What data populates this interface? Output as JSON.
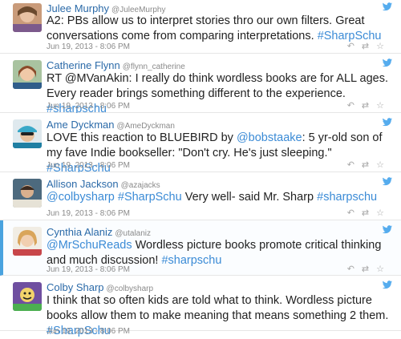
{
  "colors": {
    "accent": "#3b8bd6",
    "name": "#2b6aa8",
    "highlight_bar": "#4aa3df",
    "bird": "#55acee"
  },
  "icons": {
    "bird": "twitter-bird-icon",
    "reply": "reply-icon",
    "retweet": "retweet-icon",
    "favorite": "favorite-star-icon"
  },
  "action_glyphs": {
    "reply": "↶",
    "retweet": "⇄",
    "favorite": "☆"
  },
  "tweets": [
    {
      "name": "Julee Murphy",
      "handle": "@JuleeMurphy",
      "text_plain": "A2: PBs allow us to interpret stories thro our own filters. Great conversations come from comparing interpretations.",
      "tag": "#SharpSchu",
      "time": "Jun 19, 2013 - 8:06 PM"
    },
    {
      "name": "Catherine Flynn",
      "handle": "@flynn_catherine",
      "text_plain": "RT @MVanAkin: I really do think wordless books are for ALL ages. Every reader brings something different to the experience.",
      "tag": "#sharpschu",
      "time": "Jun 19, 2013 - 8:06 PM"
    },
    {
      "name": "Ame Dyckman",
      "handle": "@AmeDyckman",
      "text_plain": "LOVE this reaction to BLUEBIRD by",
      "mention": "@bobstaake",
      "text_plain_2": ": 5 yr-old son of my fave Indie bookseller: \"Don't cry. He's just sleeping.\"",
      "tag": "#SharpSchu",
      "time": "Jun 19, 2013 - 8:06 PM"
    },
    {
      "name": "Allison Jackson",
      "handle": "@azajacks",
      "mention": "@colbysharp",
      "tag_1": "#SharpSchu",
      "text_plain": "Very well- said Mr. Sharp",
      "tag": "#sharpschu",
      "time": "Jun 19, 2013 - 8:06 PM"
    },
    {
      "name": "Cynthia Alaniz",
      "handle": "@utalaniz",
      "mention": "@MrSchuReads",
      "text_plain": "Wordless picture books promote critical thinking and much discussion!",
      "tag": "#sharpschu",
      "time": "Jun 19, 2013 - 8:06 PM"
    },
    {
      "name": "Colby Sharp",
      "handle": "@colbysharp",
      "text_plain": "I think that so often kids are told what to think. Wordless picture books allow them to make meaning that means something 2 them.",
      "tag": "#SharpSchu",
      "time": "Jun 19, 2013 - 8:06 PM"
    }
  ]
}
